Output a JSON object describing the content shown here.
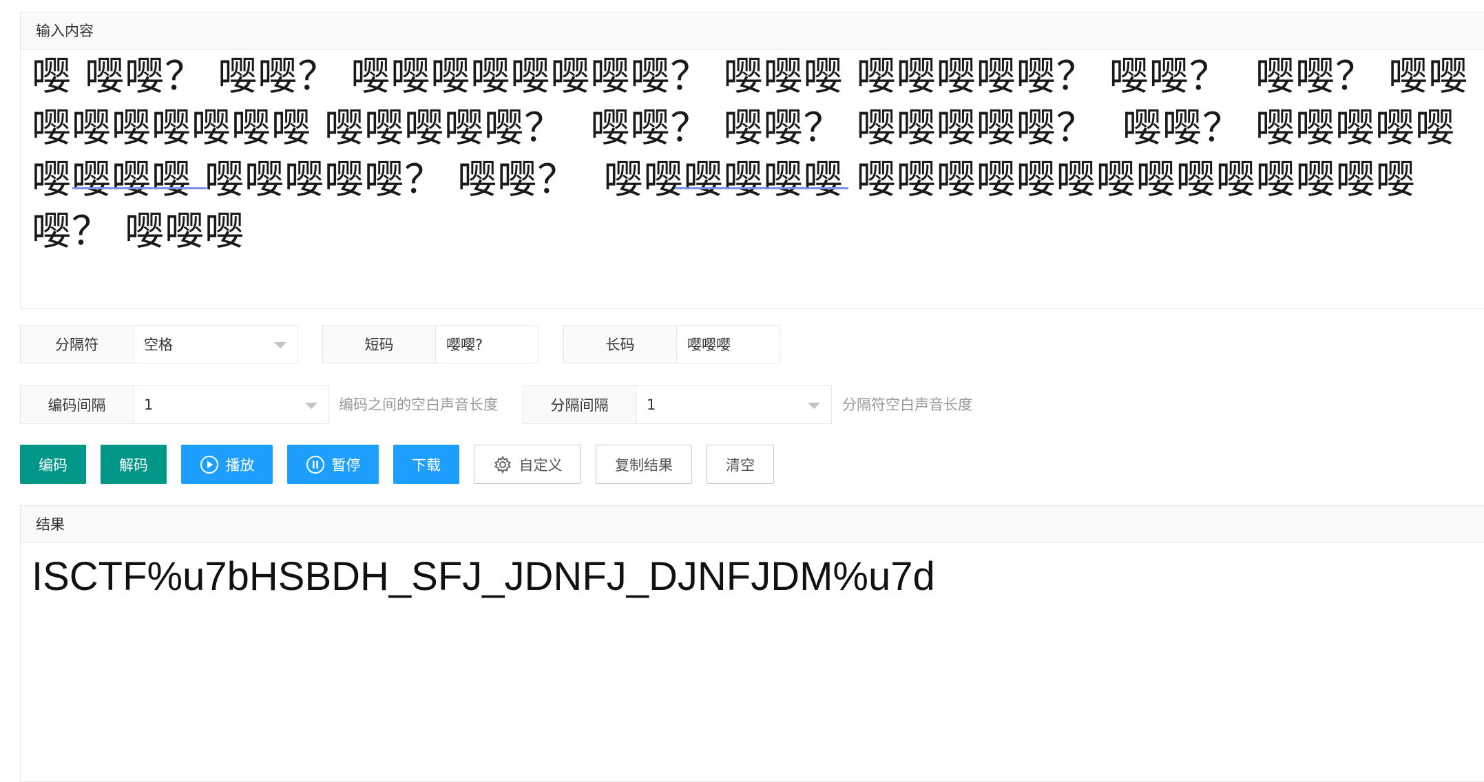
{
  "input": {
    "header": "输入内容",
    "text": "嘤 嘤嘤？ 嘤嘤？ 嘤嘤嘤嘤嘤嘤嘤嘤？ 嘤嘤嘤 嘤嘤嘤嘤嘤？ 嘤嘤？  嘤嘤？ 嘤嘤嘤嘤嘤嘤嘤嘤嘤 嘤嘤嘤嘤嘤？  嘤嘤？ 嘤嘤？ 嘤嘤嘤嘤嘤？  嘤嘤？ 嘤嘤嘤嘤嘤嘤嘤嘤嘤 嘤嘤嘤嘤嘤？ 嘤嘤？  嘤嘤嘤嘤嘤嘤 嘤嘤嘤嘤嘤嘤嘤嘤嘤嘤嘤嘤嘤嘤嘤？ 嘤嘤嘤"
  },
  "settings": {
    "separator": {
      "label": "分隔符",
      "value": "空格"
    },
    "short_code": {
      "label": "短码",
      "value": "嘤嘤?"
    },
    "long_code": {
      "label": "长码",
      "value": "嘤嘤嘤"
    },
    "code_interval": {
      "label": "编码间隔",
      "value": "1",
      "hint": "编码之间的空白声音长度"
    },
    "sep_interval": {
      "label": "分隔间隔",
      "value": "1",
      "hint": "分隔符空白声音长度"
    }
  },
  "buttons": {
    "encode": "编码",
    "decode": "解码",
    "play": "播放",
    "pause": "暂停",
    "download": "下载",
    "custom": "自定义",
    "copy": "复制结果",
    "clear": "清空"
  },
  "result": {
    "header": "结果",
    "text": "ISCTF%u7bHSBDH_SFJ_JDNFJ_DJNFJDM%u7d"
  },
  "colors": {
    "green": "#009688",
    "blue": "#1e9fff"
  }
}
